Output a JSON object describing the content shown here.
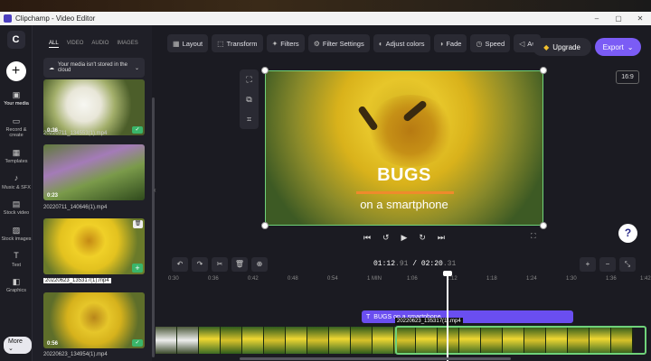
{
  "window": {
    "title": "Clipchamp - Video Editor",
    "minimize": "–",
    "maximize": "▢",
    "close": "✕"
  },
  "rail": {
    "brand": "C",
    "add": "+",
    "items": [
      {
        "icon": "▣",
        "label": "Your media"
      },
      {
        "icon": "▭",
        "label": "Record & create"
      },
      {
        "icon": "▦",
        "label": "Templates"
      },
      {
        "icon": "♪",
        "label": "Music & SFX"
      },
      {
        "icon": "▤",
        "label": "Stock video"
      },
      {
        "icon": "▨",
        "label": "Stock images"
      },
      {
        "icon": "T",
        "label": "Text"
      },
      {
        "icon": "◧",
        "label": "Graphics"
      }
    ],
    "more": "More ⌄"
  },
  "media": {
    "tabs": [
      "ALL",
      "VIDEO",
      "AUDIO",
      "IMAGES"
    ],
    "notice": "Your media isn't stored in the cloud",
    "items": [
      {
        "duration": "0:36",
        "name": "20220711_134553(1).mp4"
      },
      {
        "duration": "0:23",
        "name": "20220711_140646(1).mp4"
      },
      {
        "duration": "",
        "name": "20220623_135317(1).mp4"
      },
      {
        "duration": "0:56",
        "name": "20220623_134954(1).mp4"
      }
    ]
  },
  "toolbar": {
    "items": [
      {
        "icon": "▦",
        "label": "Layout"
      },
      {
        "icon": "⬚",
        "label": "Transform"
      },
      {
        "icon": "✦",
        "label": "Filters"
      },
      {
        "icon": "⚙",
        "label": "Filter Settings"
      },
      {
        "icon": "◐",
        "label": "Adjust colors"
      },
      {
        "icon": "◑",
        "label": "Fade"
      },
      {
        "icon": "◷",
        "label": "Speed"
      },
      {
        "icon": "◁",
        "label": "Au"
      }
    ],
    "upgrade": "Upgrade",
    "export": "Export"
  },
  "preview": {
    "aspect": "16:9",
    "title": "BUGS",
    "subtitle": "on a smartphone"
  },
  "timeline": {
    "current": "01:12",
    "current_frac": ".91",
    "total": "02:20",
    "total_frac": ".31",
    "ruler": [
      "0:30",
      "0:36",
      "0:42",
      "0:48",
      "0:54",
      "1 MIN",
      "1:06",
      "1:12",
      "1:18",
      "1:24",
      "1:30",
      "1:36",
      "1:42"
    ],
    "text_clip": "BUGS on a smartphone",
    "hover_tag": "20220623_135317(1).mp4"
  }
}
